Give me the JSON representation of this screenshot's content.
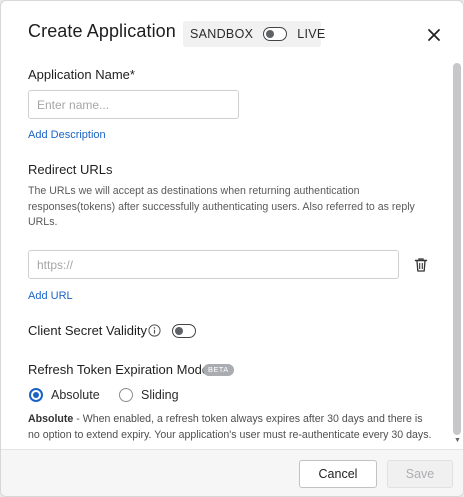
{
  "header": {
    "title": "Create Application",
    "env_left": "SANDBOX",
    "env_right": "LIVE",
    "env_live": false
  },
  "form": {
    "app_name_label": "Application Name*",
    "app_name_placeholder": "Enter name...",
    "app_name_value": "",
    "add_description": "Add Description",
    "redirect_label": "Redirect URLs",
    "redirect_help": "The URLs we will accept as destinations when returning authentication responses(tokens) after successfully authenticating users. Also referred to as reply URLs.",
    "redirect_placeholder": "https://",
    "redirect_value": "",
    "add_url": "Add URL",
    "secret_label": "Client Secret Validity",
    "secret_enabled": false,
    "refresh_label": "Refresh Token Expiration Mode",
    "refresh_badge": "BETA",
    "refresh_options": [
      "Absolute",
      "Sliding"
    ],
    "refresh_selected": "Absolute",
    "refresh_desc_title": "Absolute",
    "refresh_desc_body": " - When enabled, a refresh token always expires after 30 days and there is no option to extend expiry. Your application's user must re-authenticate every 30 days."
  },
  "footer": {
    "cancel": "Cancel",
    "save": "Save",
    "save_enabled": false
  },
  "colors": {
    "link": "#1a63c7",
    "radio_selected": "#1a63c7",
    "badge": "#a9acb1"
  },
  "icons": {
    "close": "close-icon",
    "trash": "trash-icon",
    "info": "info-icon"
  }
}
